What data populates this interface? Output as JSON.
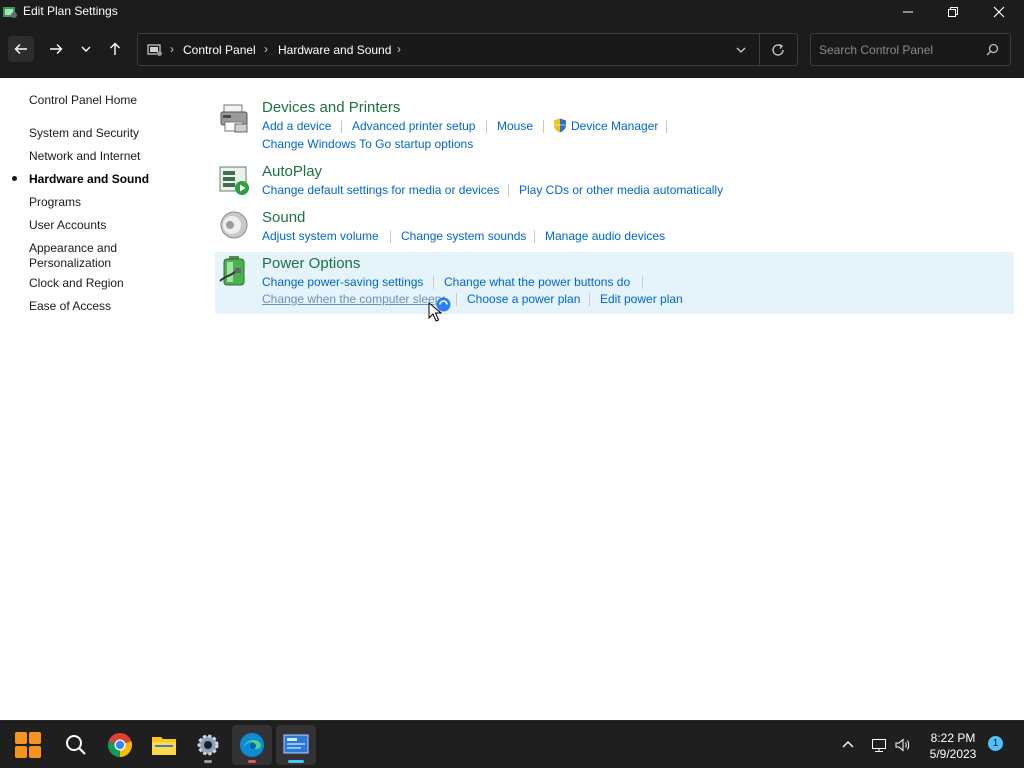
{
  "window": {
    "title": "Edit Plan Settings"
  },
  "address": {
    "crumbs": [
      "Control Panel",
      "Hardware and Sound"
    ],
    "search_placeholder": "Search Control Panel"
  },
  "sidebar": {
    "home": "Control Panel Home",
    "items": [
      {
        "label": "System and Security"
      },
      {
        "label": "Network and Internet"
      },
      {
        "label": "Hardware and Sound",
        "active": true
      },
      {
        "label": "Programs"
      },
      {
        "label": "User Accounts"
      },
      {
        "label": "Appearance and Personalization"
      },
      {
        "label": "Clock and Region"
      },
      {
        "label": "Ease of Access"
      }
    ]
  },
  "categories": [
    {
      "title": "Devices and Printers",
      "icon": "printer-icon",
      "links": [
        "Add a device",
        "Advanced printer setup",
        "Mouse",
        "Device Manager",
        "Change Windows To Go startup options"
      ]
    },
    {
      "title": "AutoPlay",
      "icon": "autoplay-icon",
      "links": [
        "Change default settings for media or devices",
        "Play CDs or other media automatically"
      ]
    },
    {
      "title": "Sound",
      "icon": "speaker-icon",
      "links": [
        "Adjust system volume",
        "Change system sounds",
        "Manage audio devices"
      ]
    },
    {
      "title": "Power Options",
      "icon": "battery-icon",
      "links": [
        "Change power-saving settings",
        "Change what the power buttons do",
        "Change when the computer sleeps",
        "Choose a power plan",
        "Edit power plan"
      ]
    }
  ],
  "taskbar": {
    "apps": [
      "start-icon",
      "search-icon",
      "chrome-icon",
      "file-explorer-icon",
      "settings-icon",
      "edge-icon",
      "control-panel-icon"
    ],
    "time": "8:22 PM",
    "date": "5/9/2023",
    "notification_count": "1"
  },
  "colors": {
    "title_green": "#1e7145",
    "link_blue": "#0066cc",
    "hover_bg": "#e5f3fb",
    "chrome_dark": "#1c1c1c"
  }
}
